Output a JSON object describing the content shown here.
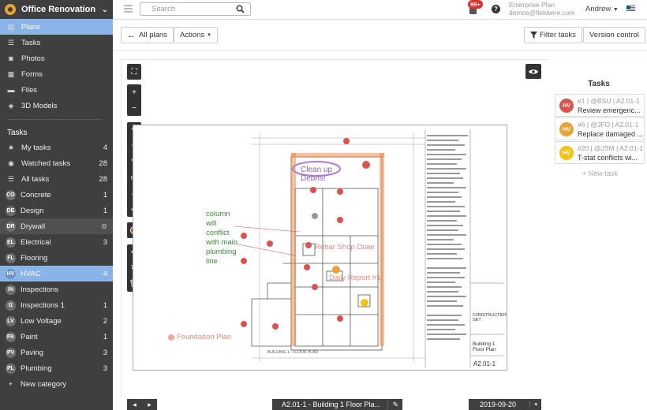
{
  "project": {
    "name": "Office Renovation"
  },
  "nav": [
    {
      "label": "Plans",
      "icon": "plans-icon",
      "glyph": "▤",
      "active": true
    },
    {
      "label": "Tasks",
      "icon": "tasks-icon",
      "glyph": "☰"
    },
    {
      "label": "Photos",
      "icon": "camera-icon",
      "glyph": "◙"
    },
    {
      "label": "Forms",
      "icon": "forms-icon",
      "glyph": "▦"
    },
    {
      "label": "Files",
      "icon": "folder-icon",
      "glyph": "▬"
    },
    {
      "label": "3D Models",
      "icon": "cube-icon",
      "glyph": "◈"
    }
  ],
  "tasks_section": {
    "title": "Tasks",
    "filters": [
      {
        "label": "My tasks",
        "icon": "star-icon",
        "glyph": "★",
        "count": "4"
      },
      {
        "label": "Watched tasks",
        "icon": "eye-icon",
        "glyph": "◉",
        "count": "28"
      },
      {
        "label": "All tasks",
        "icon": "list-icon",
        "glyph": "☰",
        "count": "28"
      }
    ]
  },
  "categories": [
    {
      "abbr": "CO",
      "label": "Concrete",
      "count": "1"
    },
    {
      "abbr": "DE",
      "label": "Design",
      "count": "1"
    },
    {
      "abbr": "DR",
      "label": "Drywall",
      "count": ""
    },
    {
      "abbr": "EL",
      "label": "Electrical",
      "count": "3"
    },
    {
      "abbr": "FL",
      "label": "Flooring",
      "count": ""
    },
    {
      "abbr": "HV",
      "label": "HVAC",
      "count": "4"
    },
    {
      "abbr": "IN",
      "label": "Inspections",
      "count": ""
    },
    {
      "abbr": "I1",
      "label": "Inspections 1",
      "count": "1"
    },
    {
      "abbr": "LV",
      "label": "Low Voltage",
      "count": "2"
    },
    {
      "abbr": "PA",
      "label": "Paint",
      "count": "1"
    },
    {
      "abbr": "PV",
      "label": "Paving",
      "count": "3"
    },
    {
      "abbr": "PL",
      "label": "Plumbing",
      "count": "3"
    }
  ],
  "new_category": "New category",
  "topbar": {
    "search_placeholder": "Search",
    "notifications": "99+",
    "help": "?",
    "plan_name": "Enterprise Plan",
    "email": "demos@fieldwire.com",
    "user": "Andrew"
  },
  "toolbar": {
    "all_plans": "All plans",
    "actions": "Actions",
    "filter_tasks": "Filter tasks",
    "version_control": "Version control"
  },
  "markups": {
    "clean_up": "Clean up",
    "debris": "Debris!",
    "column_note": [
      "column",
      "will",
      "conflict",
      "with main",
      "plumbing",
      "line"
    ],
    "rebar": "Rebar Shop Draw",
    "daily_report": "Daily Report #1",
    "foundation": "Foundation Plan",
    "building_label": "BUILDING 1 - FLOOR PLAN",
    "title_block": {
      "construction_set": "CONSTRUCTION SET",
      "sheet_title": "Building 1 Floor Plan",
      "sheet_no": "A2.01-1"
    }
  },
  "tasks_panel": {
    "title": "Tasks",
    "items": [
      {
        "pin": "HV",
        "color": "#d9534f",
        "meta": "#1 | @BSU | A2.01-1",
        "name": "Review emergenc..."
      },
      {
        "pin": "HV",
        "color": "#e8a33a",
        "meta": "#6 | @JFO | A2.01-1",
        "name": "Replace damaged ..."
      },
      {
        "pin": "HV",
        "color": "#f0c419",
        "meta": "#20 | @JSM | A2.01-1",
        "name": "T-stat conflicts wi..."
      }
    ],
    "new_task": "+ New task"
  },
  "bottom": {
    "sheet": "A2.01-1 - Building 1 Floor Pla...",
    "date": "2019-09-20"
  }
}
